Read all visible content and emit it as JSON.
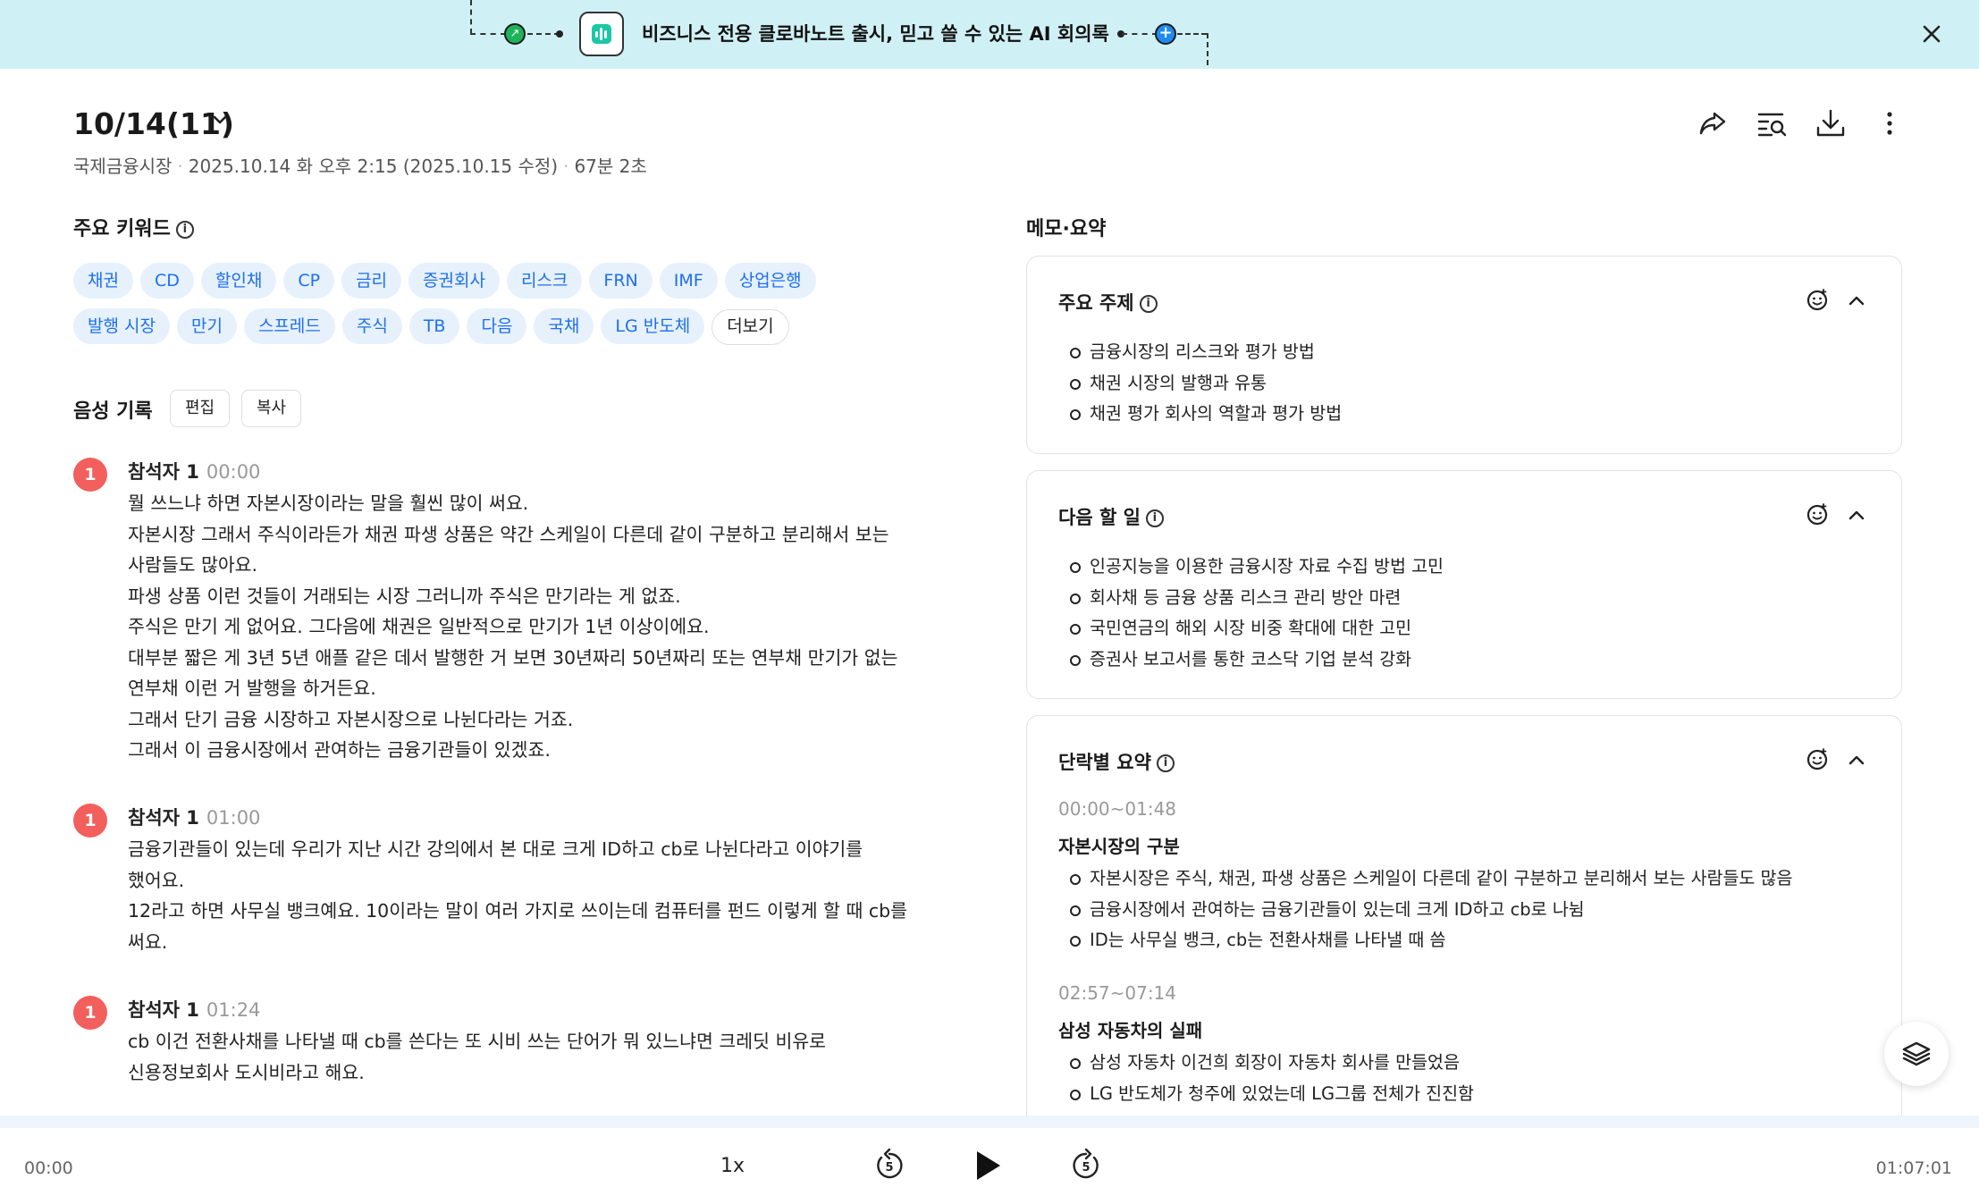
{
  "banner": {
    "text": "비즈니스 전용 클로바노트 출시, 믿고 쓸 수 있는 AI 회의록",
    "icons": [
      "link-icon",
      "audio-app-icon",
      "plus-icon",
      "close-icon"
    ]
  },
  "header": {
    "title": "10/14(11)",
    "folder": "국제금융시장",
    "datetime": "2025.10.14 화 오후 2:15 (2025.10.15 수정)",
    "duration": "67분 2초",
    "tools": [
      "share-icon",
      "search-list-icon",
      "download-icon",
      "more-vertical-icon"
    ]
  },
  "keywords": {
    "title": "주요 키워드",
    "items": [
      "채권",
      "CD",
      "할인채",
      "CP",
      "금리",
      "증권회사",
      "리스크",
      "FRN",
      "IMF",
      "상업은행",
      "발행 시장",
      "만기",
      "스프레드",
      "주식",
      "TB",
      "다음",
      "국채",
      "LG 반도체"
    ],
    "more_label": "더보기"
  },
  "voice": {
    "title": "음성 기록",
    "edit_label": "편집",
    "copy_label": "복사",
    "turns": [
      {
        "avatar": "1",
        "speaker": "참석자 1",
        "time": "00:00",
        "lines": [
          "뭘 쓰느냐 하면 자본시장이라는 말을 훨씬 많이 써요.",
          "자본시장 그래서 주식이라든가 채권 파생 상품은 약간 스케일이 다른데 같이 구분하고 분리해서 보는",
          "사람들도 많아요.",
          "파생 상품 이런 것들이 거래되는 시장 그러니까 주식은 만기라는 게 없죠.",
          "주식은 만기 게 없어요. 그다음에 채권은 일반적으로 만기가 1년 이상이에요.",
          "대부분 짧은 게 3년 5년 애플 같은 데서 발행한 거 보면 30년짜리 50년짜리 또는 연부채 만기가 없는",
          "연부채 이런 거 발행을 하거든요.",
          "그래서 단기 금융 시장하고 자본시장으로 나뉜다라는 거죠.",
          "그래서 이 금융시장에서 관여하는 금융기관들이 있겠죠."
        ]
      },
      {
        "avatar": "1",
        "speaker": "참석자 1",
        "time": "01:00",
        "lines": [
          "금융기관들이 있는데 우리가 지난 시간 강의에서 본 대로 크게 ID하고 cb로 나뉜다라고 이야기를",
          "했어요.",
          "12라고 하면 사무실 뱅크예요. 10이라는 말이 여러 가지로 쓰이는데 컴퓨터를 펀드 이렇게 할 때 cb를",
          "써요."
        ]
      },
      {
        "avatar": "1",
        "speaker": "참석자 1",
        "time": "01:24",
        "lines": [
          "cb 이건 전환사채를 나타낼 때 cb를 쓴다는 또 시비 쓰는 단어가 뭐 있느냐면 크레딧 비유로",
          "신용정보회사 도시비라고 해요."
        ]
      }
    ]
  },
  "memo": {
    "title": "메모·요약",
    "topics": {
      "title": "주요 주제",
      "items": [
        "금융시장의 리스크와 평가 방법",
        "채권 시장의 발행과 유통",
        "채권 평가 회사의 역할과 평가 방법"
      ]
    },
    "todo": {
      "title": "다음 할 일",
      "items": [
        "인공지능을 이용한 금융시장 자료 수집 방법 고민",
        "회사채 등 금융 상품 리스크 관리 방안 마련",
        "국민연금의 해외 시장 비중 확대에 대한 고민",
        "증권사 보고서를 통한 코스닥 기업 분석 강화"
      ]
    },
    "paragraphs": {
      "title": "단락별 요약",
      "sections": [
        {
          "time": "00:00~01:48",
          "heading": "자본시장의 구분",
          "items": [
            "자본시장은 주식, 채권, 파생 상품은 스케일이 다른데 같이 구분하고 분리해서 보는 사람들도 많음",
            "금융시장에서 관여하는 금융기관들이 있는데 크게 ID하고 cb로 나뉨",
            "ID는 사무실 뱅크, cb는 전환사채를 나타낼 때 씀"
          ]
        },
        {
          "time": "02:57~07:14",
          "heading": "삼성 자동차의 실패",
          "items": [
            "삼성 자동차 이건희 회장이 자동차 회사를 만들었음",
            "LG 반도체가 청주에 있었는데 LG그룹 전체가 진진함"
          ]
        }
      ]
    }
  },
  "player": {
    "current": "00:00",
    "total": "01:07:01",
    "speed": "1x",
    "rewind_seconds": "5",
    "forward_seconds": "5"
  }
}
